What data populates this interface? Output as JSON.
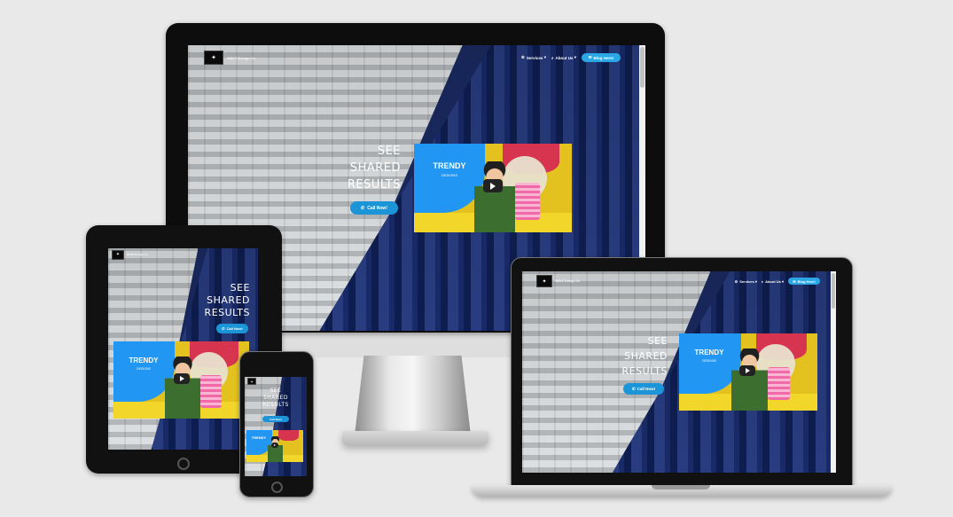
{
  "site": {
    "brand": "WAVZ Design Co",
    "nav": {
      "services": "Services",
      "about": "About Us",
      "cta": "Blog Here!"
    },
    "hero": {
      "line1": "SEE",
      "line2": "SHARED",
      "line3": "RESULTS",
      "call_button": "Call Now!"
    },
    "video": {
      "title": "TRENDY",
      "subtitle": "DESIGNS"
    }
  },
  "colors": {
    "accent": "#2aa7e4",
    "building_blue": "#1b2c66",
    "video_blue": "#1f8fdc",
    "video_yellow": "#e3c21f"
  },
  "icons": {
    "phone": "phone-icon",
    "search": "search-icon",
    "envelope": "envelope-icon",
    "play": "play-icon",
    "logo": "logo-icon"
  }
}
